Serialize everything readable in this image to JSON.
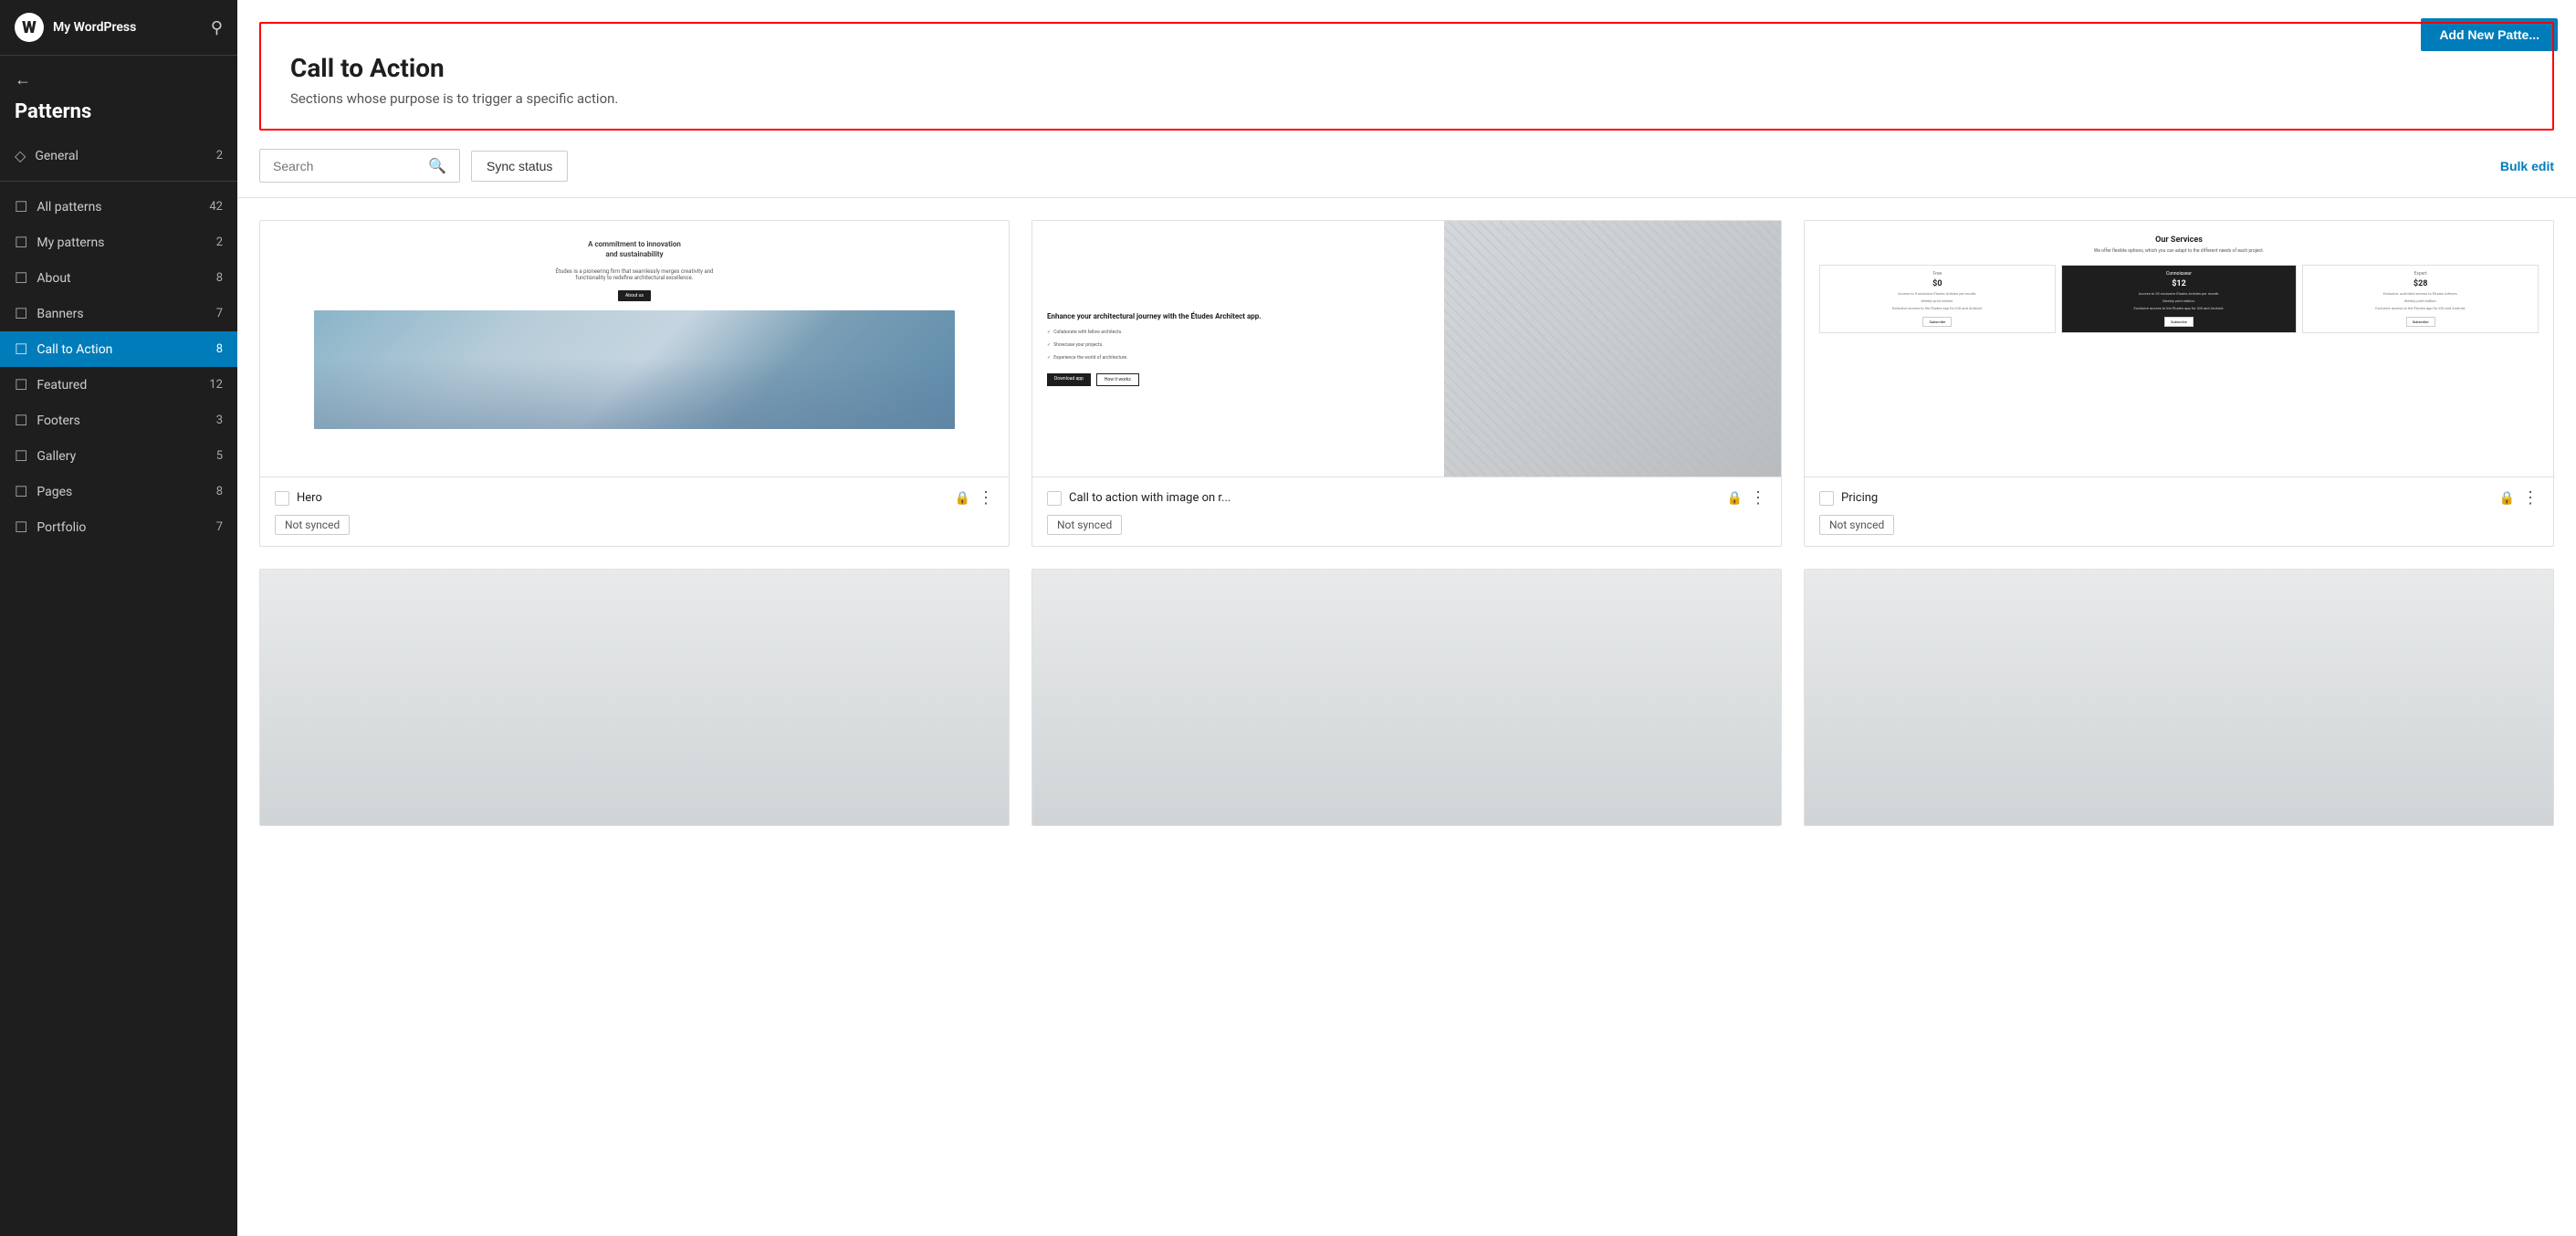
{
  "site": {
    "name": "My WordPress",
    "logo_char": "W"
  },
  "sidebar": {
    "back_label": "",
    "section_title": "Patterns",
    "items": [
      {
        "id": "general",
        "label": "General",
        "count": "2",
        "icon": "◇",
        "active": false
      },
      {
        "id": "divider1",
        "type": "divider"
      },
      {
        "id": "all-patterns",
        "label": "All patterns",
        "count": "42",
        "icon": "☐",
        "active": false
      },
      {
        "id": "my-patterns",
        "label": "My patterns",
        "count": "2",
        "icon": "☐",
        "active": false
      },
      {
        "id": "about",
        "label": "About",
        "count": "8",
        "icon": "☐",
        "active": false
      },
      {
        "id": "banners",
        "label": "Banners",
        "count": "7",
        "icon": "☐",
        "active": false
      },
      {
        "id": "call-to-action",
        "label": "Call to Action",
        "count": "8",
        "icon": "☐",
        "active": true
      },
      {
        "id": "featured",
        "label": "Featured",
        "count": "12",
        "icon": "☐",
        "active": false
      },
      {
        "id": "footers",
        "label": "Footers",
        "count": "3",
        "icon": "☐",
        "active": false
      },
      {
        "id": "gallery",
        "label": "Gallery",
        "count": "5",
        "icon": "☐",
        "active": false
      },
      {
        "id": "pages",
        "label": "Pages",
        "count": "8",
        "icon": "☐",
        "active": false
      },
      {
        "id": "portfolio",
        "label": "Portfolio",
        "count": "7",
        "icon": "☐",
        "active": false
      }
    ]
  },
  "header": {
    "title": "Call to Action",
    "subtitle": "Sections whose purpose is to trigger a specific action.",
    "add_new_label": "Add New Patte..."
  },
  "toolbar": {
    "search_placeholder": "Search",
    "sync_status_label": "Sync status",
    "bulk_edit_label": "Bulk edit"
  },
  "patterns": [
    {
      "id": "hero",
      "name": "Hero",
      "badge": "Not synced",
      "locked": true,
      "preview_type": "hero"
    },
    {
      "id": "cta-image",
      "name": "Call to action with image on r...",
      "badge": "Not synced",
      "locked": true,
      "preview_type": "cta"
    },
    {
      "id": "pricing",
      "name": "Pricing",
      "badge": "Not synced",
      "locked": true,
      "preview_type": "pricing"
    },
    {
      "id": "placeholder1",
      "name": "",
      "badge": "",
      "locked": false,
      "preview_type": "placeholder"
    },
    {
      "id": "placeholder2",
      "name": "",
      "badge": "",
      "locked": false,
      "preview_type": "placeholder"
    },
    {
      "id": "placeholder3",
      "name": "",
      "badge": "",
      "locked": false,
      "preview_type": "placeholder"
    }
  ],
  "pricing_preview": {
    "title": "Our Services",
    "subtitle": "We offer flexible options, which you can adapt to the different needs of each project.",
    "tiers": [
      {
        "name": "Free",
        "price": "$0",
        "featured": false
      },
      {
        "name": "Connoisseur",
        "price": "$12",
        "featured": true
      },
      {
        "name": "Expert",
        "price": "$28",
        "featured": false
      }
    ]
  },
  "hero_preview": {
    "title": "A commitment to innovation\nand sustainability",
    "subtitle": "Études is a pioneering firm that seamlessly merges creativity and\nfunctionality to redefine architectural excellence."
  },
  "cta_preview": {
    "title": "Enhance your architectural journey with the Études Architect app.",
    "items": [
      "Collaborate with fellow architects.",
      "Showcase your projects.",
      "Experience the world of architecture."
    ]
  }
}
